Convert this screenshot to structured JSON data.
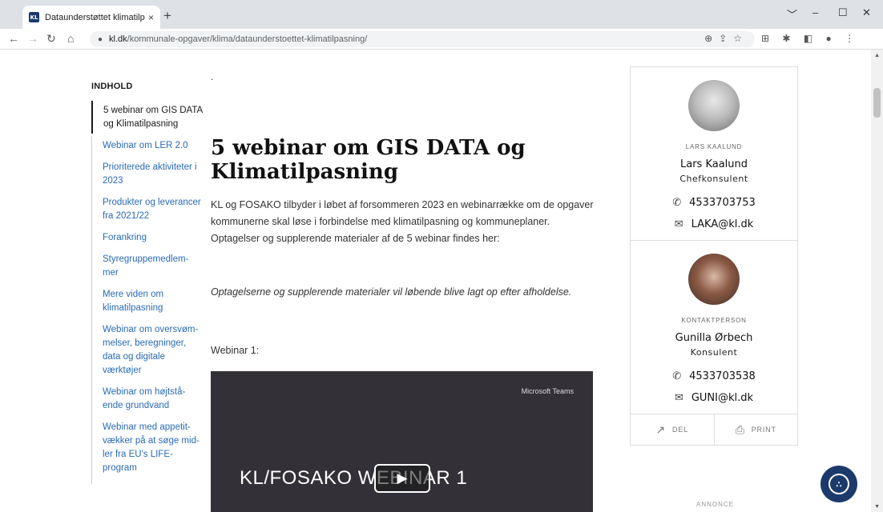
{
  "browser": {
    "tab_title": "Dataunderstøttet klimatilpasning",
    "tab_close": "×",
    "new_tab": "+",
    "favicon_text": "KL",
    "url_domain": "kl.dk",
    "url_path": "/kommunale-opgaver/klima/dataunderstoettet-klimatilpasning/",
    "window_controls": [
      "﹀",
      "–",
      "☐",
      "✕"
    ]
  },
  "toc": {
    "heading": "INDHOLD",
    "items": [
      {
        "label": "5 webinar om GIS DATA og Klimatilpasning",
        "active": true
      },
      {
        "label": "Webinar om LER 2.0"
      },
      {
        "label": "Prioriterede aktiviteter i 2023"
      },
      {
        "label": "Produkter og leverancer fra 2021/22"
      },
      {
        "label": "Forankring"
      },
      {
        "label": "Styregruppemedlem-mer"
      },
      {
        "label": "Mere viden om klimatilpasning"
      },
      {
        "label": "Webinar om oversvøm-melser, beregninger, data og digitale værktøjer"
      },
      {
        "label": "Webinar om højtstå-ende grundvand"
      },
      {
        "label": "Webinar med appetit-vækker på at søge mid-ler fra EU's LIFE-program"
      }
    ]
  },
  "main": {
    "dot": ".",
    "heading": "5 webinar om GIS DATA og Klimatilpasning",
    "intro": "KL og FOSAKO tilbyder i løbet af forsommeren 2023 en webinarrække om de opgaver kommunerne skal løse i forbindelse med klimatilpasning og kommuneplaner. Optagelser og supplerende materialer af de 5 webinar findes her:",
    "note": "Optagelserne og supplerende materialer vil løbende blive lagt op efter afholdelse.",
    "webinar_label": "Webinar 1:",
    "video": {
      "brand": "Microsoft Teams",
      "title": "KL/FOSAKO WEBINAR 1",
      "play": "▶"
    }
  },
  "contacts": [
    {
      "role": "LARS KAALUND",
      "name": "Lars Kaalund",
      "title": "Chefkonsulent",
      "phone": "4533703753",
      "email": "LAKA@kl.dk"
    },
    {
      "role": "KONTAKTPERSON",
      "name": "Gunilla Ørbech",
      "title": "Konsulent",
      "phone": "4533703538",
      "email": "GUNI@kl.dk"
    }
  ],
  "share": {
    "del": "DEL",
    "print": "PRINT"
  },
  "annonce": "ANNONCE",
  "icons": {
    "phone": "✆",
    "mail": "✉",
    "share": "↗",
    "print": "⎙",
    "lock": "🔒︎",
    "chat": "∴"
  }
}
